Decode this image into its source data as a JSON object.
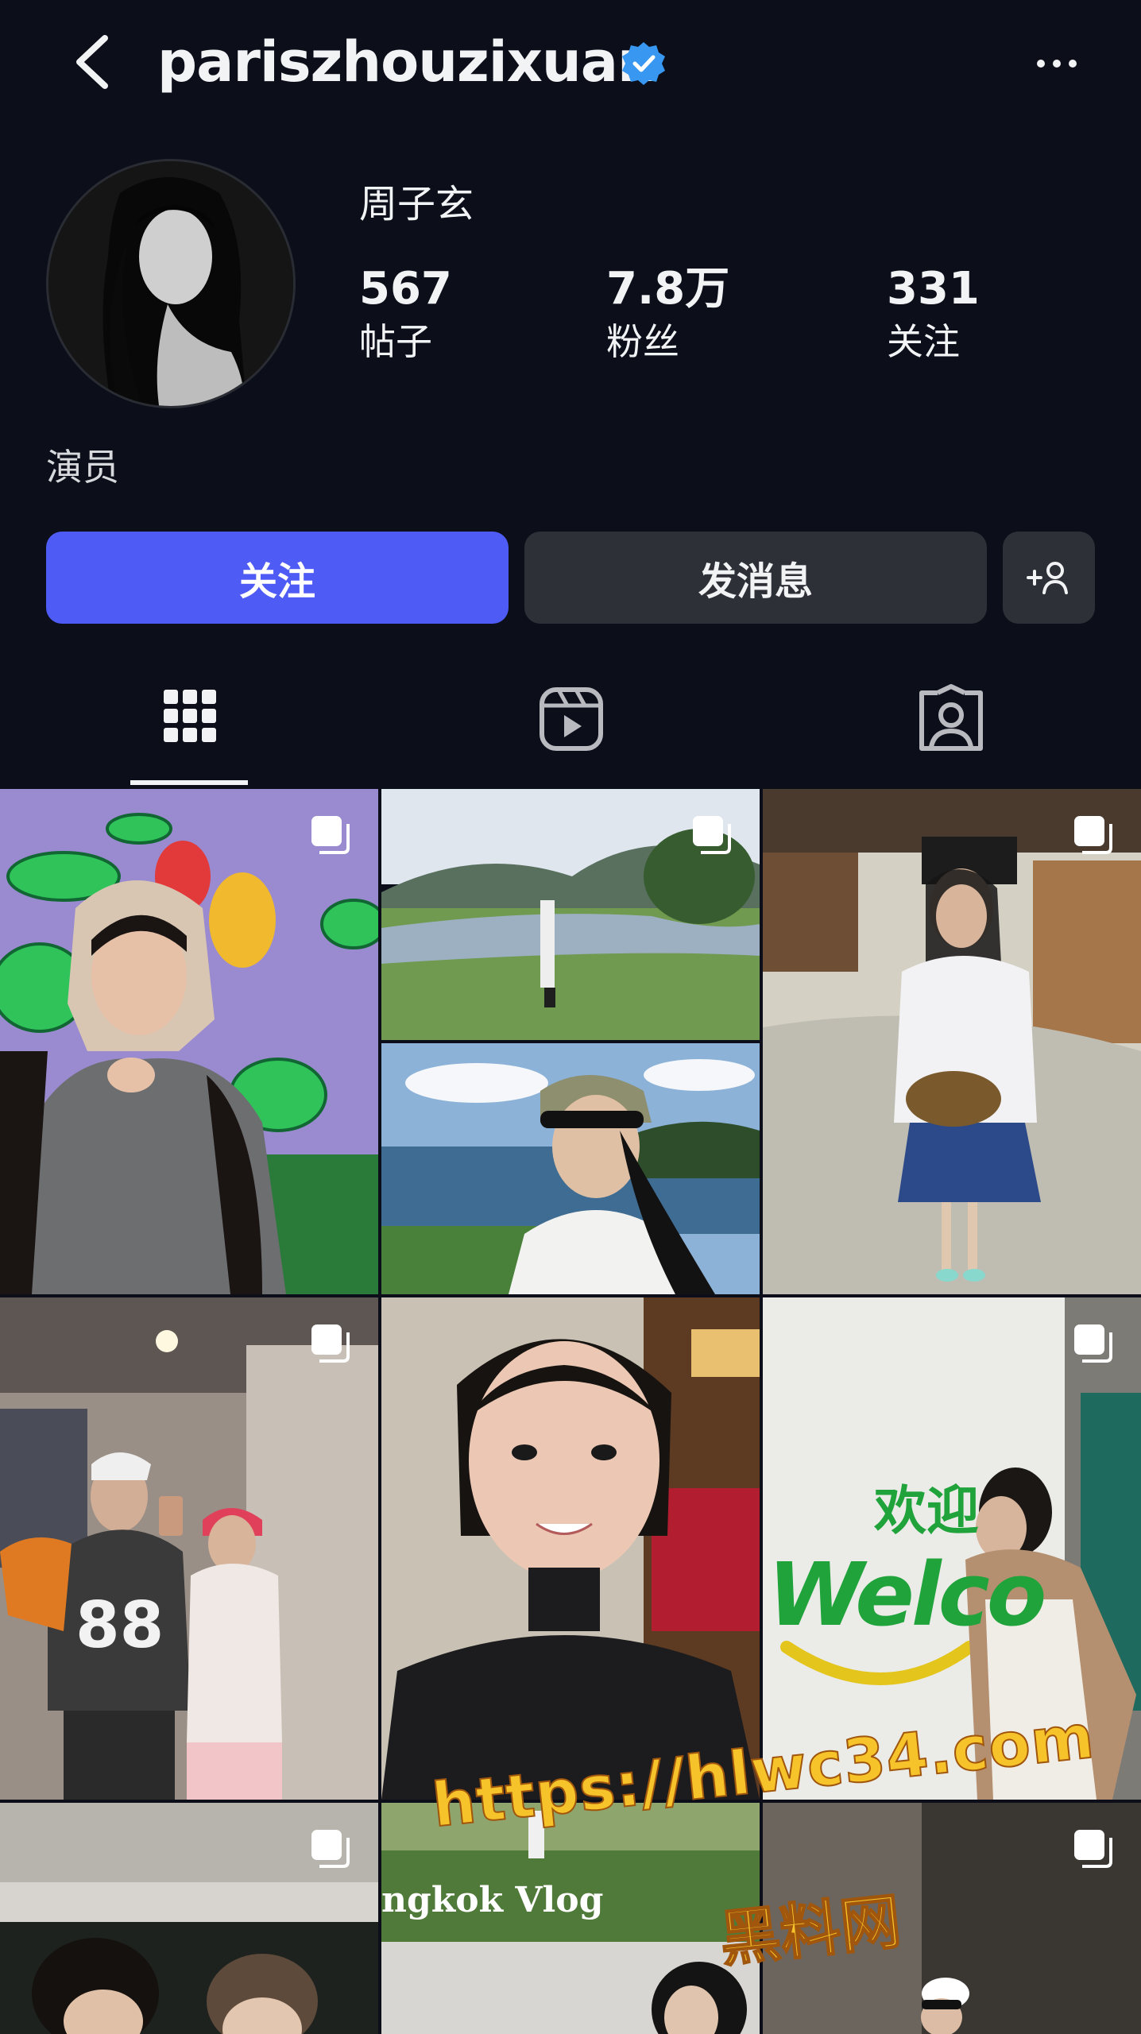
{
  "header": {
    "username": "pariszhouzixuan"
  },
  "profile": {
    "display_name": "周子玄",
    "bio": "演员",
    "stats": [
      {
        "value": "567",
        "label": "帖子"
      },
      {
        "value": "7.8万",
        "label": "粉丝"
      },
      {
        "value": "331",
        "label": "关注"
      }
    ]
  },
  "actions": {
    "follow_label": "关注",
    "message_label": "发消息",
    "add_icon": "person-plus-icon"
  },
  "tabs": [
    {
      "icon": "grid-icon",
      "active": true
    },
    {
      "icon": "reels-icon",
      "active": false
    },
    {
      "icon": "tagged-icon",
      "active": false
    }
  ],
  "posts": {
    "post_6_sign_1": "欢迎",
    "post_6_sign_2": "Welco",
    "post_8_caption": "ngkok Vlog",
    "watermark_url": "https://hlwc34.com",
    "watermark_name": "黑料网"
  },
  "colors": {
    "background": "#0c0f1a",
    "follow_button": "#4e5bf5",
    "secondary_button": "#2e3037",
    "verified_badge": "#3897f0"
  }
}
